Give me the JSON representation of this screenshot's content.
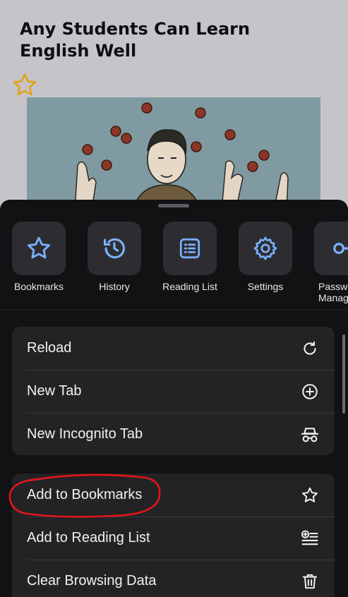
{
  "article": {
    "title": "Any Students Can Learn English Well"
  },
  "top_actions": [
    {
      "label": "Bookmarks",
      "icon": "star-icon"
    },
    {
      "label": "History",
      "icon": "history-icon"
    },
    {
      "label": "Reading List",
      "icon": "reading-list-icon"
    },
    {
      "label": "Settings",
      "icon": "gear-icon"
    },
    {
      "label": "Passw\nManag",
      "icon": "key-icon"
    }
  ],
  "menu_group_1": [
    {
      "label": "Reload",
      "icon": "reload-icon"
    },
    {
      "label": "New Tab",
      "icon": "plus-circle-icon"
    },
    {
      "label": "New Incognito Tab",
      "icon": "incognito-icon"
    }
  ],
  "menu_group_2": [
    {
      "label": "Add to Bookmarks",
      "icon": "star-outline-icon"
    },
    {
      "label": "Add to Reading List",
      "icon": "add-to-list-icon"
    },
    {
      "label": "Clear Browsing Data",
      "icon": "trash-icon"
    }
  ],
  "colors": {
    "accent": "#7ab1ff",
    "page_background": "#c6c4c9",
    "sheet_background": "#121214",
    "annotation": "#e3151b",
    "bookmark_star": "#e2a21b"
  }
}
